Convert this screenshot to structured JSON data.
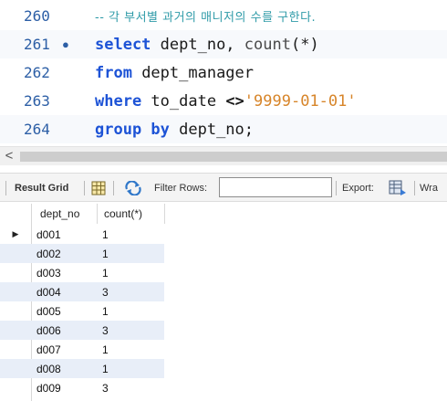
{
  "editor": {
    "lines": [
      {
        "num": "260",
        "marker": "",
        "comment": "-- 각 부서별 과거의 매니저의 수를 구한다."
      },
      {
        "num": "261",
        "marker": "●",
        "kw1": "select",
        "text1": " dept_no, ",
        "fn": "count",
        "text2": "(*)"
      },
      {
        "num": "262",
        "marker": "",
        "kw1": "from",
        "text1": " dept_manager"
      },
      {
        "num": "263",
        "marker": "",
        "kw1": "where",
        "text1": " to_date ",
        "op": "<>",
        "str": "'9999-01-01'"
      },
      {
        "num": "264",
        "marker": "",
        "kw1": "group by",
        "text1": " dept_no;"
      }
    ]
  },
  "scrollbar": {
    "left_arrow": "<"
  },
  "toolbar": {
    "result_grid": "Result Grid",
    "filter_rows": "Filter Rows:",
    "filter_value": "",
    "export": "Export:",
    "wrap": "Wra"
  },
  "grid": {
    "columns": [
      "dept_no",
      "count(*)"
    ],
    "rows": [
      [
        "d001",
        "1"
      ],
      [
        "d002",
        "1"
      ],
      [
        "d003",
        "1"
      ],
      [
        "d004",
        "3"
      ],
      [
        "d005",
        "1"
      ],
      [
        "d006",
        "3"
      ],
      [
        "d007",
        "1"
      ],
      [
        "d008",
        "1"
      ],
      [
        "d009",
        "3"
      ]
    ],
    "current_row_marker": "▶"
  },
  "colors": {
    "keyword": "#1d53d6",
    "string": "#d7852a",
    "comment": "#2f9ba8",
    "line_number": "#2d5fa6",
    "alt_row": "#e8eef8"
  }
}
